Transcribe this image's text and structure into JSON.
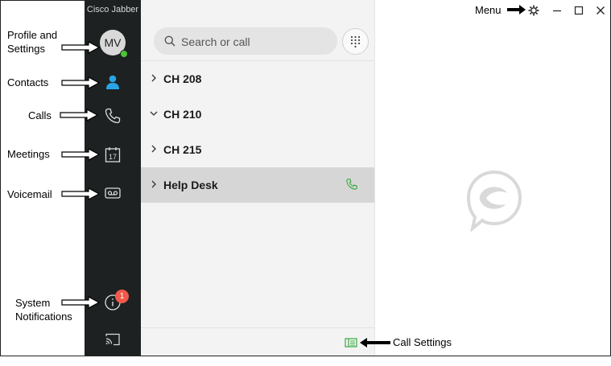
{
  "app": {
    "title": "Cisco Jabber"
  },
  "profile": {
    "initials": "MV"
  },
  "annotations": {
    "profile": "Profile and Settings",
    "contacts": "Contacts",
    "calls": "Calls",
    "meetings": "Meetings",
    "voicemail": "Voicemail",
    "system_notifications": "System Notifications",
    "menu": "Menu",
    "call_settings": "Call Settings"
  },
  "meetings_icon_day": "17",
  "notifications": {
    "count": "1"
  },
  "search": {
    "placeholder": "Search or call"
  },
  "groups": [
    {
      "label": "CH 208",
      "expanded": false
    },
    {
      "label": "CH 210",
      "expanded": true
    },
    {
      "label": "CH 215",
      "expanded": false
    },
    {
      "label": "Help Desk",
      "expanded": false,
      "selected": true
    }
  ],
  "colors": {
    "sidebar": "#1d2122",
    "panel": "#f3f3f3",
    "accent_green": "#4cc437",
    "contacts_blue": "#2aa4e8",
    "badge_red": "#f05a4a"
  }
}
